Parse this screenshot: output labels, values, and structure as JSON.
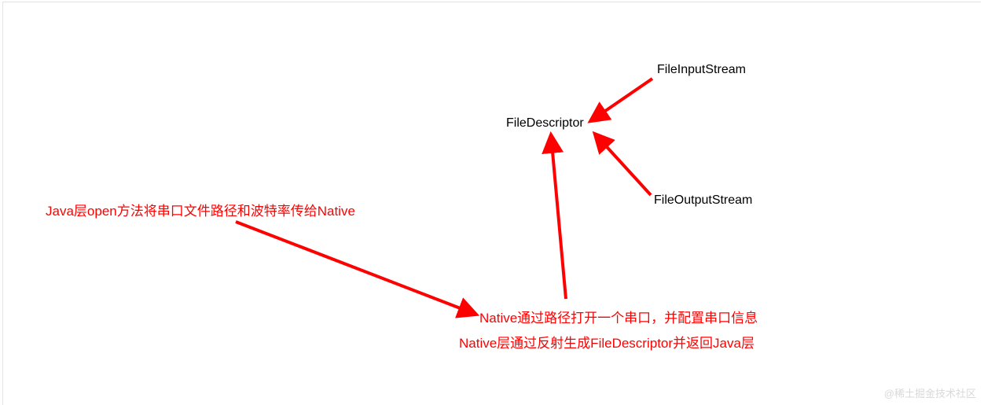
{
  "nodes": {
    "file_input_stream": "FileInputStream",
    "file_descriptor": "FileDescriptor",
    "file_output_stream": "FileOutputStream"
  },
  "annotations": {
    "java_open": "Java层open方法将串口文件路径和波特率传给Native",
    "native_open": "Native通过路径打开一个串口，并配置串口信息",
    "native_reflect": "Native层通过反射生成FileDescriptor并返回Java层"
  },
  "watermark": "@稀土掘金技术社区",
  "colors": {
    "arrow": "#ff0000",
    "text_black": "#000000",
    "text_red": "#ff0000"
  }
}
